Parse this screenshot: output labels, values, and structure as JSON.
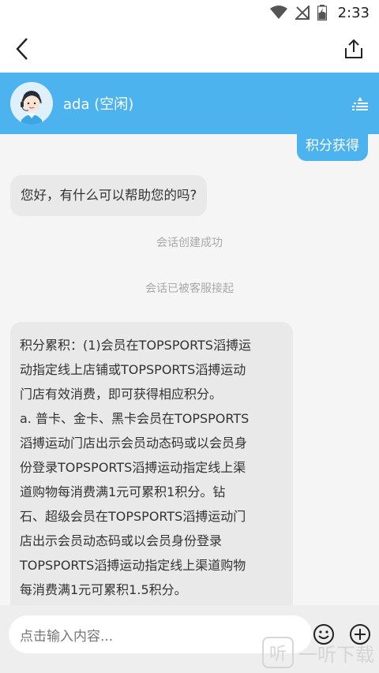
{
  "status_bar": {
    "time": "2:33",
    "icons": [
      "wifi-icon",
      "no-signal-icon",
      "battery-charging-icon"
    ]
  },
  "nav": {
    "back_icon": "chevron-left-icon",
    "share_icon": "share-icon"
  },
  "agent": {
    "name": "ada (空闲)",
    "avatar_icon": "agent-avatar",
    "menu_icon": "list-menu-icon"
  },
  "chat": {
    "sent_message": "积分获得",
    "greeting": "您好，有什么可以帮助您的吗?",
    "system_messages": [
      "会话创建成功",
      "会话已被客服接起"
    ],
    "long_message_lines": [
      "积分累积：(1)会员在TOPSPORTS滔搏运",
      "动指定线上店铺或TOPSPORTS滔搏运动",
      "门店有效消费，即可获得相应积分。",
      "a. 普卡、金卡、黑卡会员在TOPSPORTS",
      "滔搏运动门店出示会员动态码或以会员身",
      "份登录TOPSPORTS滔搏运动指定线上渠",
      "道购物每消费满1元可累积1积分。钻",
      "石、超级会员在TOPSPORTS滔搏运动门",
      "店出示会员动态码或以会员身份登录",
      "TOPSPORTS滔搏运动指定线上渠道购物",
      "每消费满1元可累积1.5积分。"
    ]
  },
  "input": {
    "placeholder": "点击输入内容...",
    "emoji_icon": "emoji-icon",
    "plus_icon": "plus-icon"
  },
  "watermark": {
    "text": "一听下载",
    "logo": "听"
  },
  "colors": {
    "accent": "#4cb3ee",
    "bubble_left": "#e9e9e9",
    "system_text": "#a9a9a9"
  }
}
